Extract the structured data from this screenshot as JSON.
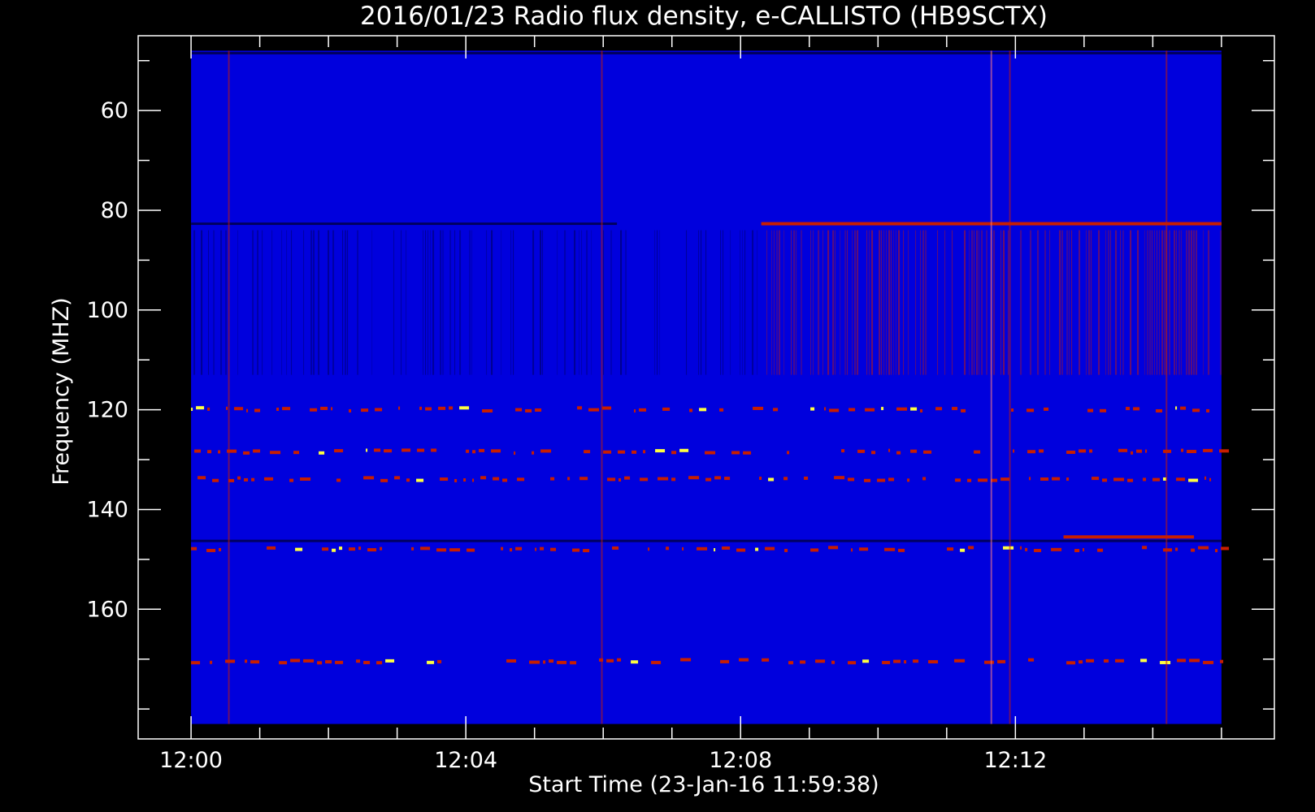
{
  "chart_data": {
    "type": "heatmap",
    "title": "2016/01/23  Radio flux density, e-CALLISTO (HB9SCTX)",
    "xlabel": "Start Time (23-Jan-16 11:59:38)",
    "ylabel": "Frequency (MHZ)",
    "x_ticks": [
      {
        "label": "12:00",
        "minute": 0
      },
      {
        "label": "12:04",
        "minute": 4
      },
      {
        "label": "12:08",
        "minute": 8
      },
      {
        "label": "12:12",
        "minute": 12
      }
    ],
    "y_ticks": [
      60,
      80,
      100,
      120,
      140,
      160
    ],
    "xlim_minutes": [
      -0.77,
      15.77
    ],
    "ylim_mhz": [
      45,
      186
    ],
    "data_extent": {
      "minutes": [
        0,
        15
      ],
      "mhz": [
        48,
        183
      ]
    },
    "inverted_y": true,
    "grid": false,
    "colors": {
      "background": "#0000dd",
      "emission": "#c81e00",
      "peak": "#ffff40",
      "absorption": "#000060",
      "axis": "#ffffff"
    },
    "horizontal_features": [
      {
        "mhz": 48.5,
        "kind": "absorption"
      },
      {
        "mhz": 82.7,
        "kind": "absorption",
        "from_min": 0,
        "to_min": 6.2
      },
      {
        "mhz": 82.7,
        "kind": "emission",
        "from_min": 8.3,
        "to_min": 15
      },
      {
        "mhz": 120,
        "kind": "patchy-emission"
      },
      {
        "mhz": 128.5,
        "kind": "patchy-emission"
      },
      {
        "mhz": 134,
        "kind": "patchy-emission"
      },
      {
        "mhz": 146.3,
        "kind": "absorption"
      },
      {
        "mhz": 145.5,
        "kind": "emission",
        "from_min": 12.7,
        "to_min": 14.6
      },
      {
        "mhz": 148,
        "kind": "patchy-emission"
      },
      {
        "mhz": 170.5,
        "kind": "patchy-emission"
      }
    ],
    "vertical_features": [
      {
        "minute": 0.55,
        "kind": "emission"
      },
      {
        "minute": 5.98,
        "kind": "emission"
      },
      {
        "minute": 11.65,
        "kind": "peak"
      },
      {
        "minute": 11.92,
        "kind": "emission"
      },
      {
        "minute": 14.2,
        "kind": "emission"
      }
    ],
    "banded_region": {
      "mhz": [
        84,
        113
      ],
      "kind": "vertical-striation"
    }
  }
}
